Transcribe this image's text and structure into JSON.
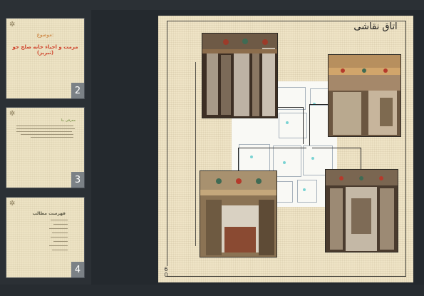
{
  "thumbnails": [
    {
      "number": "2",
      "subtitle": "موضوع:",
      "title": "مرمت و احیاء خانه صلح جو (تبریز)"
    },
    {
      "number": "3",
      "heading": "معرفی بنا"
    },
    {
      "number": "4",
      "heading": "فهرست مطالب"
    }
  ],
  "current_slide": {
    "title": "اتاق نقاشی",
    "page_number": "6 0",
    "photos": [
      {
        "name": "painted-room-doors-photo"
      },
      {
        "name": "painted-room-ceiling-photo"
      },
      {
        "name": "painted-room-window-photo"
      },
      {
        "name": "painted-room-alcove-photo"
      }
    ]
  },
  "colors": {
    "app_background": "#1f2429",
    "slide_paper": "#efe4c6",
    "thumb_title_red": "#d0442c",
    "thumb_subtitle_orange": "#c8762d"
  }
}
